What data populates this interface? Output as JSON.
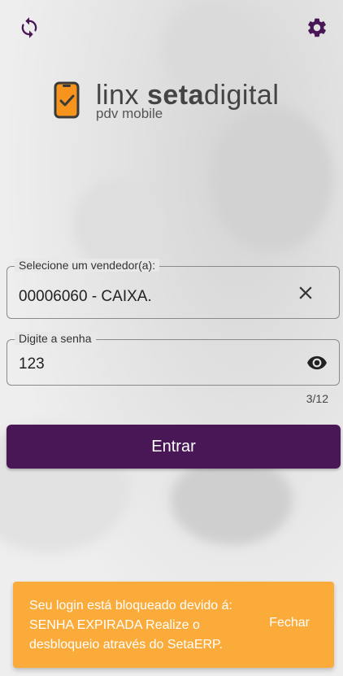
{
  "header": {
    "refresh_icon": "refresh-icon",
    "settings_icon": "gear-icon"
  },
  "logo": {
    "brand_light": "linx ",
    "brand_bold": "seta",
    "brand_suffix": "digital",
    "subtitle": "pdv mobile"
  },
  "form": {
    "seller_label": "Selecione um vendedor(a):",
    "seller_value": "00006060 - CAIXA.",
    "password_label": "Digite a senha",
    "password_value": "123",
    "char_counter": "3/12",
    "submit_label": "Entrar"
  },
  "snackbar": {
    "message": "Seu login está bloqueado devido á: SENHA EXPIRADA Realize o desbloqueio através do SetaERP.",
    "action_label": "Fechar"
  },
  "colors": {
    "primary": "#491756",
    "snackbar": "#fbab3a",
    "logo_orange": "#f7941d"
  }
}
